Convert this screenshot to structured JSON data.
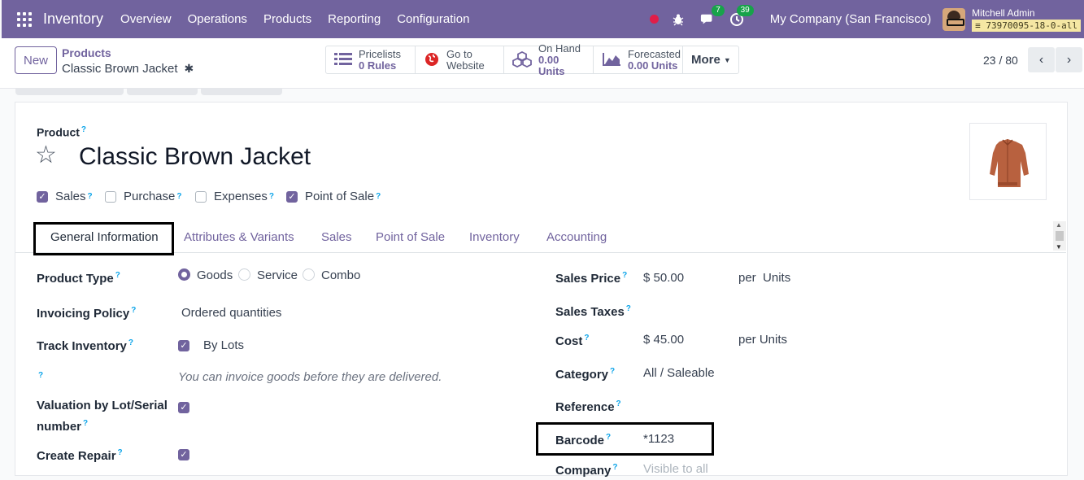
{
  "navbar": {
    "app_name": "Inventory",
    "menu": [
      "Overview",
      "Operations",
      "Products",
      "Reporting",
      "Configuration"
    ],
    "chat_count": "7",
    "activity_count": "39",
    "company": "My Company (San Francisco)",
    "user_name": "Mitchell Admin",
    "db_name": "73970095-18-0-all"
  },
  "control": {
    "new_label": "New",
    "breadcrumb_parent": "Products",
    "breadcrumb_current": "Classic Brown Jacket",
    "smart_buttons": [
      {
        "line1": "Pricelists",
        "line2": "0 Rules",
        "icon": "list-icon"
      },
      {
        "line1": "Go to",
        "line2": "Website",
        "icon": "globe-icon"
      },
      {
        "line1": "On Hand",
        "line2": "0.00 Units",
        "icon": "cubes-icon"
      },
      {
        "line1": "Forecasted",
        "line2": "0.00 Units",
        "icon": "area-chart-icon"
      }
    ],
    "more_label": "More",
    "pager": "23 / 80"
  },
  "product": {
    "type_label": "Product",
    "name": "Classic Brown Jacket",
    "checkboxes": [
      {
        "label": "Sales",
        "checked": true
      },
      {
        "label": "Purchase",
        "checked": false
      },
      {
        "label": "Expenses",
        "checked": false
      },
      {
        "label": "Point of Sale",
        "checked": true
      }
    ]
  },
  "tabs": [
    "General Information",
    "Attributes & Variants",
    "Sales",
    "Point of Sale",
    "Inventory",
    "Accounting"
  ],
  "left_fields": {
    "product_type_label": "Product Type",
    "product_type_options": [
      "Goods",
      "Service",
      "Combo"
    ],
    "invoicing_policy_label": "Invoicing Policy",
    "invoicing_policy_value": "Ordered quantities",
    "track_inventory_label": "Track Inventory",
    "track_inventory_value": "By Lots",
    "help_text": "You can invoice goods before they are delivered.",
    "valuation_label_1": "Valuation by Lot/Serial",
    "valuation_label_2": "number",
    "create_repair_label": "Create Repair"
  },
  "right_fields": {
    "sales_price_label": "Sales Price",
    "sales_price_value": "$ 50.00",
    "sales_price_unit": "per  Units",
    "sales_taxes_label": "Sales Taxes",
    "cost_label": "Cost",
    "cost_value": "$ 45.00",
    "cost_unit": "per Units",
    "category_label": "Category",
    "category_value": "All / Saleable",
    "reference_label": "Reference",
    "barcode_label": "Barcode",
    "barcode_value": "*1123",
    "company_label": "Company",
    "company_placeholder": "Visible to all"
  },
  "help_mark": "?",
  "colors": {
    "brand": "#71639e",
    "help": "#0ea5e9",
    "badge": "#17a34a"
  }
}
